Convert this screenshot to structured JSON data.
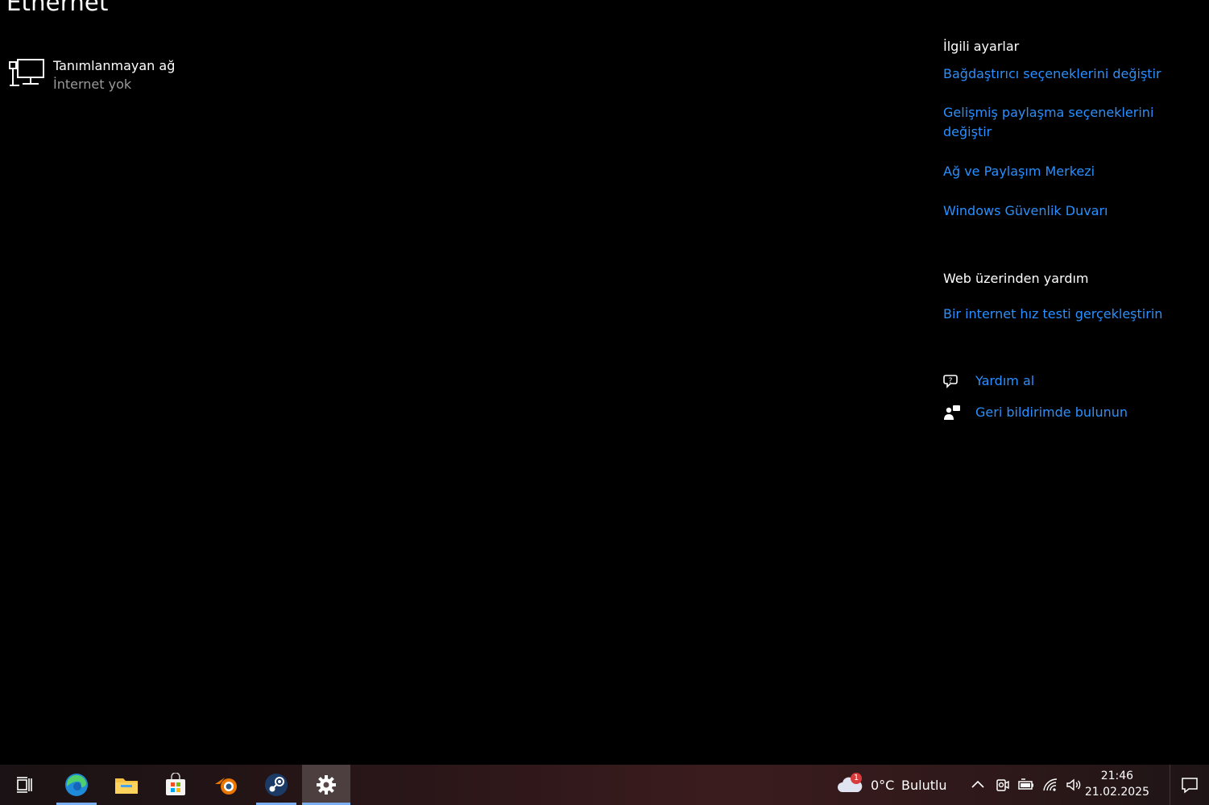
{
  "page": {
    "title": "Ethernet"
  },
  "network": {
    "name": "Tanımlanmayan ağ",
    "status": "İnternet yok"
  },
  "related_settings": {
    "heading": "İlgili ayarlar",
    "links": [
      "Bağdaştırıcı seçeneklerini değiştir",
      "Gelişmiş paylaşma seçeneklerini",
      "değiştir",
      "Ağ ve Paylaşım Merkezi",
      "Windows Güvenlik Duvarı"
    ]
  },
  "web_help": {
    "heading": "Web üzerinden yardım",
    "speed_test": "Bir internet hız testi gerçekleştirin"
  },
  "help": {
    "get_help": "Yardım al",
    "feedback": "Geri bildirimde bulunun"
  },
  "taskbar": {
    "weather": {
      "temp": "0°C",
      "condition": "Bulutlu",
      "badge": "1"
    },
    "clock": {
      "time": "21:46",
      "date": "21.02.2025"
    }
  },
  "colors": {
    "link": "#2a8fff",
    "accent_underline": "#7aaef0"
  }
}
